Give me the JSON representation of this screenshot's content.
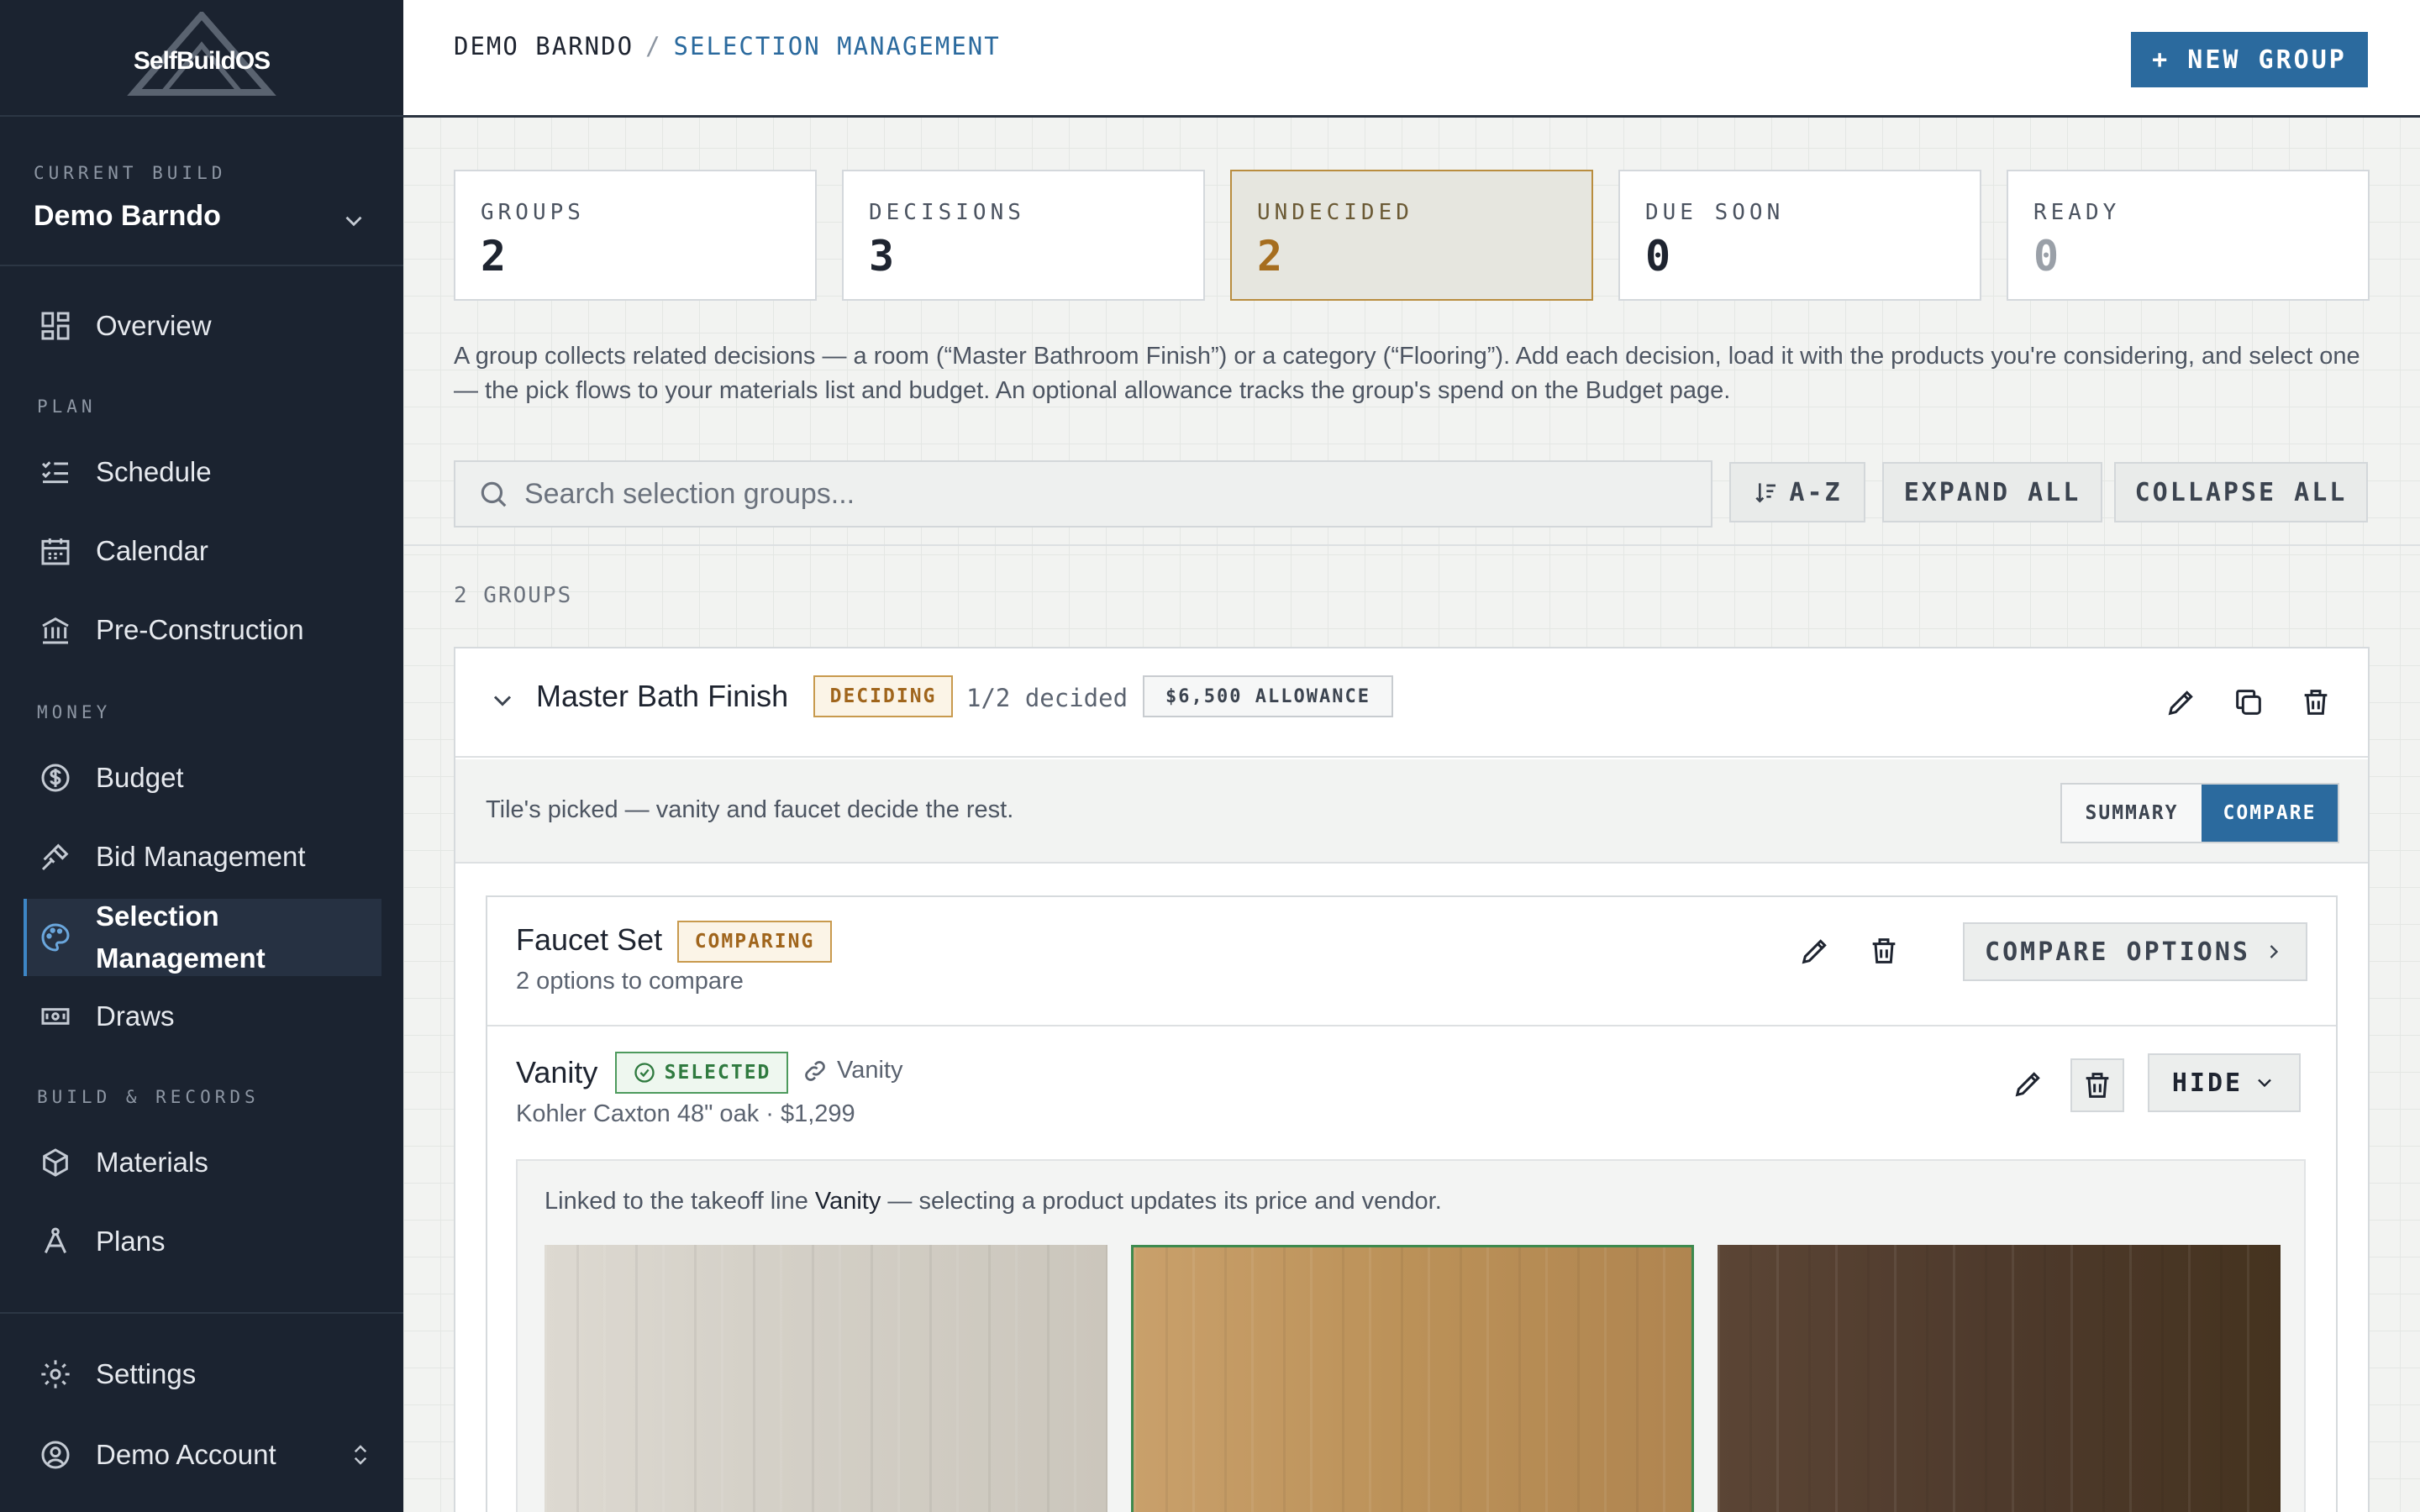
{
  "sidebar": {
    "logo": "SelfBuildOS",
    "current_build_label": "CURRENT BUILD",
    "build_name": "Demo Barndo",
    "overview": "Overview",
    "plan_label": "PLAN",
    "schedule": "Schedule",
    "calendar": "Calendar",
    "preconstruction": "Pre-Construction",
    "money_label": "MONEY",
    "budget": "Budget",
    "bid_management": "Bid Management",
    "selection_management": "Selection Management",
    "draws": "Draws",
    "build_records_label": "BUILD & RECORDS",
    "materials": "Materials",
    "plans": "Plans",
    "settings": "Settings",
    "account": "Demo Account"
  },
  "header": {
    "crumb_root": "DEMO BARNDO",
    "crumb_sep": "/",
    "crumb_current": "SELECTION MANAGEMENT",
    "new_group": "+ NEW GROUP"
  },
  "stats": [
    {
      "label": "GROUPS",
      "value": "2"
    },
    {
      "label": "DECISIONS",
      "value": "3"
    },
    {
      "label": "UNDECIDED",
      "value": "2"
    },
    {
      "label": "DUE SOON",
      "value": "0"
    },
    {
      "label": "READY",
      "value": "0"
    }
  ],
  "description": "A group collects related decisions — a room (“Master Bathroom Finish”) or a category (“Flooring”). Add each decision, load it with the products you're considering, and select one — the pick flows to your materials list and budget. An optional allowance tracks the group's spend on the Budget page.",
  "toolbar": {
    "search_placeholder": "Search selection groups...",
    "sort": "A-Z",
    "expand_all": "EXPAND ALL",
    "collapse_all": "COLLAPSE ALL"
  },
  "group_count": "2 GROUPS",
  "group": {
    "title": "Master Bath Finish",
    "status": "DECIDING",
    "decided": "1/2 decided",
    "allowance": "$6,500 ALLOWANCE",
    "note": "Tile's picked — vanity and faucet decide the rest.",
    "view_summary": "SUMMARY",
    "view_compare": "COMPARE",
    "decisions": [
      {
        "title": "Faucet Set",
        "status": "COMPARING",
        "subtitle": "2 options to compare",
        "action": "COMPARE OPTIONS"
      },
      {
        "title": "Vanity",
        "status": "SELECTED",
        "linked_label": "Vanity",
        "subtitle": "Kohler Caxton 48\" oak · $1,299",
        "action": "HIDE",
        "linked_text_pre": "Linked to the takeoff line ",
        "linked_text_item": "Vanity",
        "linked_text_post": " — selecting a product updates its price and vendor."
      }
    ]
  },
  "colors": {
    "sidebar_bg": "#1b2330",
    "accent": "#2b6a9e",
    "warning": "#a0651c",
    "success": "#2f7a3f"
  }
}
